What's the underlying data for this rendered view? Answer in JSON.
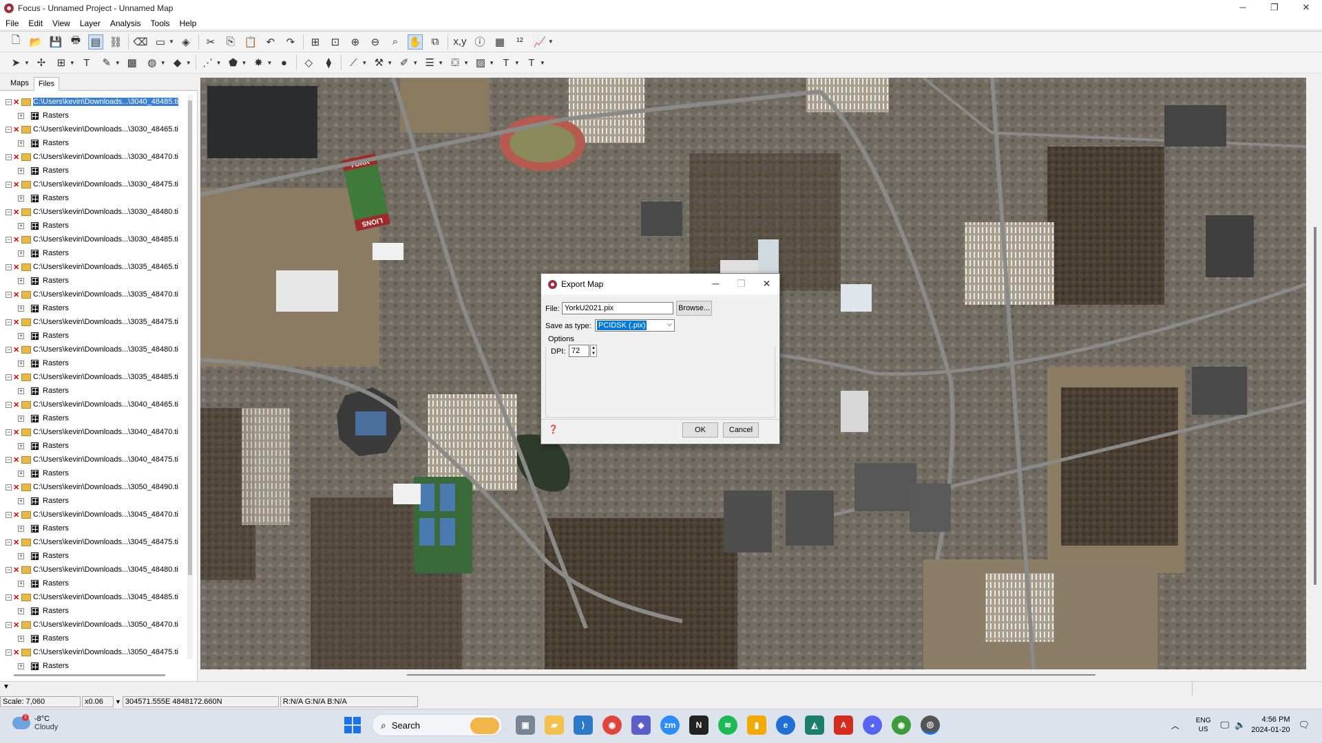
{
  "window": {
    "title": "Focus - Unnamed Project - Unnamed Map",
    "minimize": "─",
    "maximize": "❐",
    "close": "✕"
  },
  "menu": [
    "File",
    "Edit",
    "View",
    "Layer",
    "Analysis",
    "Tools",
    "Help"
  ],
  "panel": {
    "tabs": [
      "Maps",
      "Files"
    ],
    "active_tab": "Files",
    "child_label": "Rasters",
    "files": [
      "C:\\Users\\kevin\\Downloads...\\3040_48485.ti",
      "C:\\Users\\kevin\\Downloads...\\3030_48465.ti",
      "C:\\Users\\kevin\\Downloads...\\3030_48470.ti",
      "C:\\Users\\kevin\\Downloads...\\3030_48475.ti",
      "C:\\Users\\kevin\\Downloads...\\3030_48480.ti",
      "C:\\Users\\kevin\\Downloads...\\3030_48485.ti",
      "C:\\Users\\kevin\\Downloads...\\3035_48465.ti",
      "C:\\Users\\kevin\\Downloads...\\3035_48470.ti",
      "C:\\Users\\kevin\\Downloads...\\3035_48475.ti",
      "C:\\Users\\kevin\\Downloads...\\3035_48480.ti",
      "C:\\Users\\kevin\\Downloads...\\3035_48485.ti",
      "C:\\Users\\kevin\\Downloads...\\3040_48465.ti",
      "C:\\Users\\kevin\\Downloads...\\3040_48470.ti",
      "C:\\Users\\kevin\\Downloads...\\3040_48475.ti",
      "C:\\Users\\kevin\\Downloads...\\3050_48490.ti",
      "C:\\Users\\kevin\\Downloads...\\3045_48470.ti",
      "C:\\Users\\kevin\\Downloads...\\3045_48475.ti",
      "C:\\Users\\kevin\\Downloads...\\3045_48480.ti",
      "C:\\Users\\kevin\\Downloads...\\3045_48485.ti",
      "C:\\Users\\kevin\\Downloads...\\3050_48470.ti",
      "C:\\Users\\kevin\\Downloads...\\3050_48475.ti"
    ],
    "selected_index": 0
  },
  "dialog": {
    "title": "Export Map",
    "file_label": "File:",
    "file_value": "YorkU2021.pix",
    "browse_label": "Browse...",
    "save_as_label": "Save as type:",
    "save_as_value": "PCIDSK (.pix)",
    "options_label": "Options",
    "dpi_label": "DPI:",
    "dpi_value": "72",
    "ok_label": "OK",
    "cancel_label": "Cancel"
  },
  "status": {
    "scale": "Scale: 7,060",
    "zoom": "x0.06",
    "coords": "304571.555E 4848172.660N",
    "rgb": "R:N/A G:N/A B:N/A"
  },
  "map_labels": {
    "field_top": "YORK",
    "field_bottom": "LIONS"
  },
  "taskbar": {
    "temperature": "-8°C",
    "condition": "Cloudy",
    "weather_badge": "1",
    "search_label": "Search",
    "lang_1": "ENG",
    "lang_2": "US",
    "time": "4:56 PM",
    "date": "2024-01-20"
  },
  "colors": {
    "selection": "#3a7fd5",
    "accent": "#0078d7",
    "taskbar": "#dde3ec"
  }
}
